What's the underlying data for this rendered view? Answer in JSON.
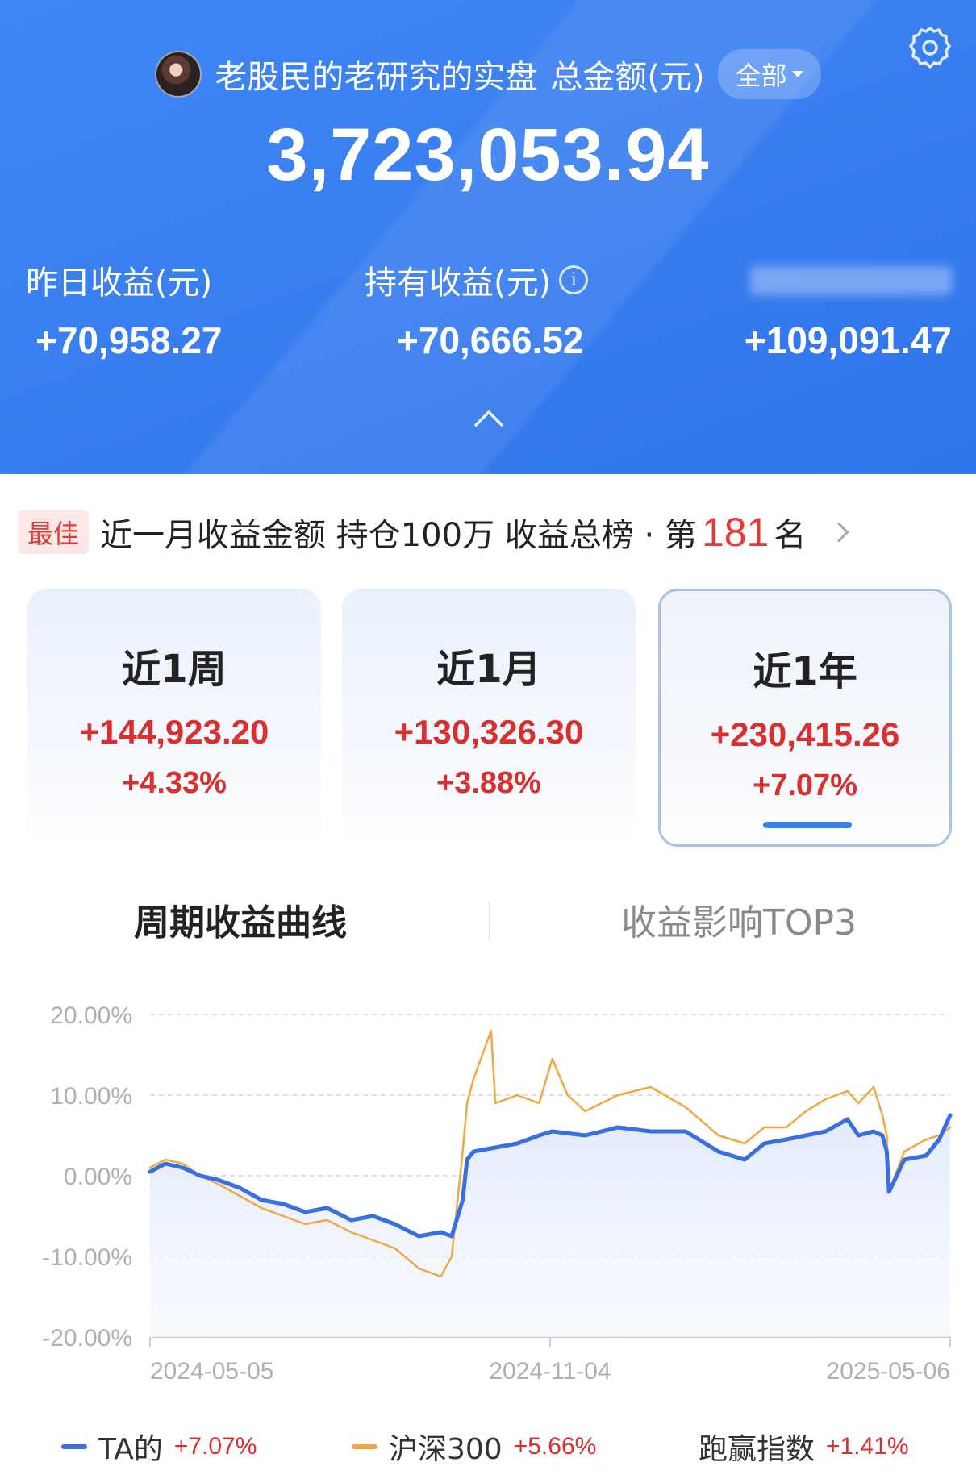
{
  "header": {
    "account_name": "老股民的老研究的实盘",
    "total_label": "总金额(元)",
    "scope_label": "全部",
    "total_amount": "3,723,053.94",
    "stats": [
      {
        "label": "昨日收益(元)",
        "value": "+70,958.27"
      },
      {
        "label": "持有收益(元)",
        "value": "+70,666.52"
      },
      {
        "label": "",
        "value": "+109,091.47"
      }
    ]
  },
  "rank": {
    "badge": "最佳",
    "text_prefix": "近一月收益金额 持仓100万 收益总榜 · 第",
    "rank_number": "181",
    "text_suffix": "名"
  },
  "periods": [
    {
      "title": "近1周",
      "amount": "+144,923.20",
      "pct": "+4.33%"
    },
    {
      "title": "近1月",
      "amount": "+130,326.30",
      "pct": "+3.88%"
    },
    {
      "title": "近1年",
      "amount": "+230,415.26",
      "pct": "+7.07%",
      "selected": true
    }
  ],
  "tabs": {
    "active": "周期收益曲线",
    "inactive": "收益影响TOP3"
  },
  "chart_data": {
    "type": "line",
    "y_tick_labels": [
      "20.00%",
      "10.00%",
      "0.00%",
      "-10.00%",
      "-20.00%"
    ],
    "x_tick_labels": [
      "2024-05-05",
      "2024-11-04",
      "2025-05-06"
    ],
    "ylim": [
      -20,
      20
    ],
    "xlim": [
      "2024-05-05",
      "2025-05-06"
    ],
    "grid": true,
    "legend_position": "bottom",
    "series": [
      {
        "name": "TA的",
        "color": "#3a6fe0",
        "x": [
          "2024-05-05",
          "2024-05-12",
          "2024-05-20",
          "2024-05-28",
          "2024-06-05",
          "2024-06-15",
          "2024-06-25",
          "2024-07-05",
          "2024-07-15",
          "2024-07-25",
          "2024-08-05",
          "2024-08-15",
          "2024-08-25",
          "2024-09-05",
          "2024-09-15",
          "2024-09-20",
          "2024-09-25",
          "2024-09-27",
          "2024-09-30",
          "2024-10-10",
          "2024-10-20",
          "2024-10-30",
          "2024-11-05",
          "2024-11-20",
          "2024-12-05",
          "2024-12-20",
          "2025-01-05",
          "2025-01-20",
          "2025-02-01",
          "2025-02-10",
          "2025-02-20",
          "2025-03-01",
          "2025-03-10",
          "2025-03-20",
          "2025-03-25",
          "2025-04-01",
          "2025-04-05",
          "2025-04-07",
          "2025-04-08",
          "2025-04-15",
          "2025-04-25",
          "2025-05-01",
          "2025-05-06"
        ],
        "values": [
          0.5,
          1.5,
          1.0,
          0.0,
          -0.5,
          -1.5,
          -3.0,
          -3.5,
          -4.5,
          -4.0,
          -5.5,
          -5.0,
          -6.0,
          -7.5,
          -7.0,
          -7.5,
          -3.0,
          2.0,
          3.0,
          3.5,
          4.0,
          5.0,
          5.5,
          5.0,
          6.0,
          5.5,
          5.5,
          3.0,
          2.0,
          4.0,
          4.5,
          5.0,
          5.5,
          7.0,
          5.0,
          5.5,
          5.0,
          3.0,
          -2.0,
          2.0,
          2.5,
          4.5,
          7.5
        ]
      },
      {
        "name": "沪深300",
        "color": "#f0a845",
        "x": [
          "2024-05-05",
          "2024-05-12",
          "2024-05-20",
          "2024-05-28",
          "2024-06-05",
          "2024-06-15",
          "2024-06-25",
          "2024-07-05",
          "2024-07-15",
          "2024-07-25",
          "2024-08-05",
          "2024-08-15",
          "2024-08-25",
          "2024-09-05",
          "2024-09-15",
          "2024-09-20",
          "2024-09-25",
          "2024-09-27",
          "2024-09-30",
          "2024-10-08",
          "2024-10-10",
          "2024-10-20",
          "2024-10-30",
          "2024-11-05",
          "2024-11-12",
          "2024-11-20",
          "2024-12-05",
          "2024-12-20",
          "2025-01-05",
          "2025-01-20",
          "2025-02-01",
          "2025-02-10",
          "2025-02-20",
          "2025-03-01",
          "2025-03-10",
          "2025-03-20",
          "2025-03-25",
          "2025-04-01",
          "2025-04-05",
          "2025-04-07",
          "2025-04-08",
          "2025-04-15",
          "2025-04-25",
          "2025-05-01",
          "2025-05-06"
        ],
        "values": [
          1.0,
          2.0,
          1.5,
          0.0,
          -1.0,
          -2.5,
          -4.0,
          -5.0,
          -6.0,
          -5.5,
          -7.0,
          -8.0,
          -9.0,
          -11.5,
          -12.5,
          -10.0,
          3.0,
          9.0,
          12.0,
          18.0,
          9.0,
          10.0,
          9.0,
          14.5,
          10.0,
          8.0,
          10.0,
          11.0,
          8.5,
          5.0,
          4.0,
          6.0,
          6.0,
          8.0,
          9.5,
          10.5,
          9.0,
          11.0,
          7.5,
          5.0,
          -2.0,
          3.0,
          4.5,
          5.0,
          6.0
        ]
      }
    ]
  },
  "legend": [
    {
      "name": "TA的",
      "value": "+7.07%",
      "color": "#3a6fe0"
    },
    {
      "name": "沪深300",
      "value": "+5.66%",
      "color": "#f0a845"
    },
    {
      "name": "跑赢指数",
      "value": "+1.41%",
      "color": ""
    }
  ]
}
